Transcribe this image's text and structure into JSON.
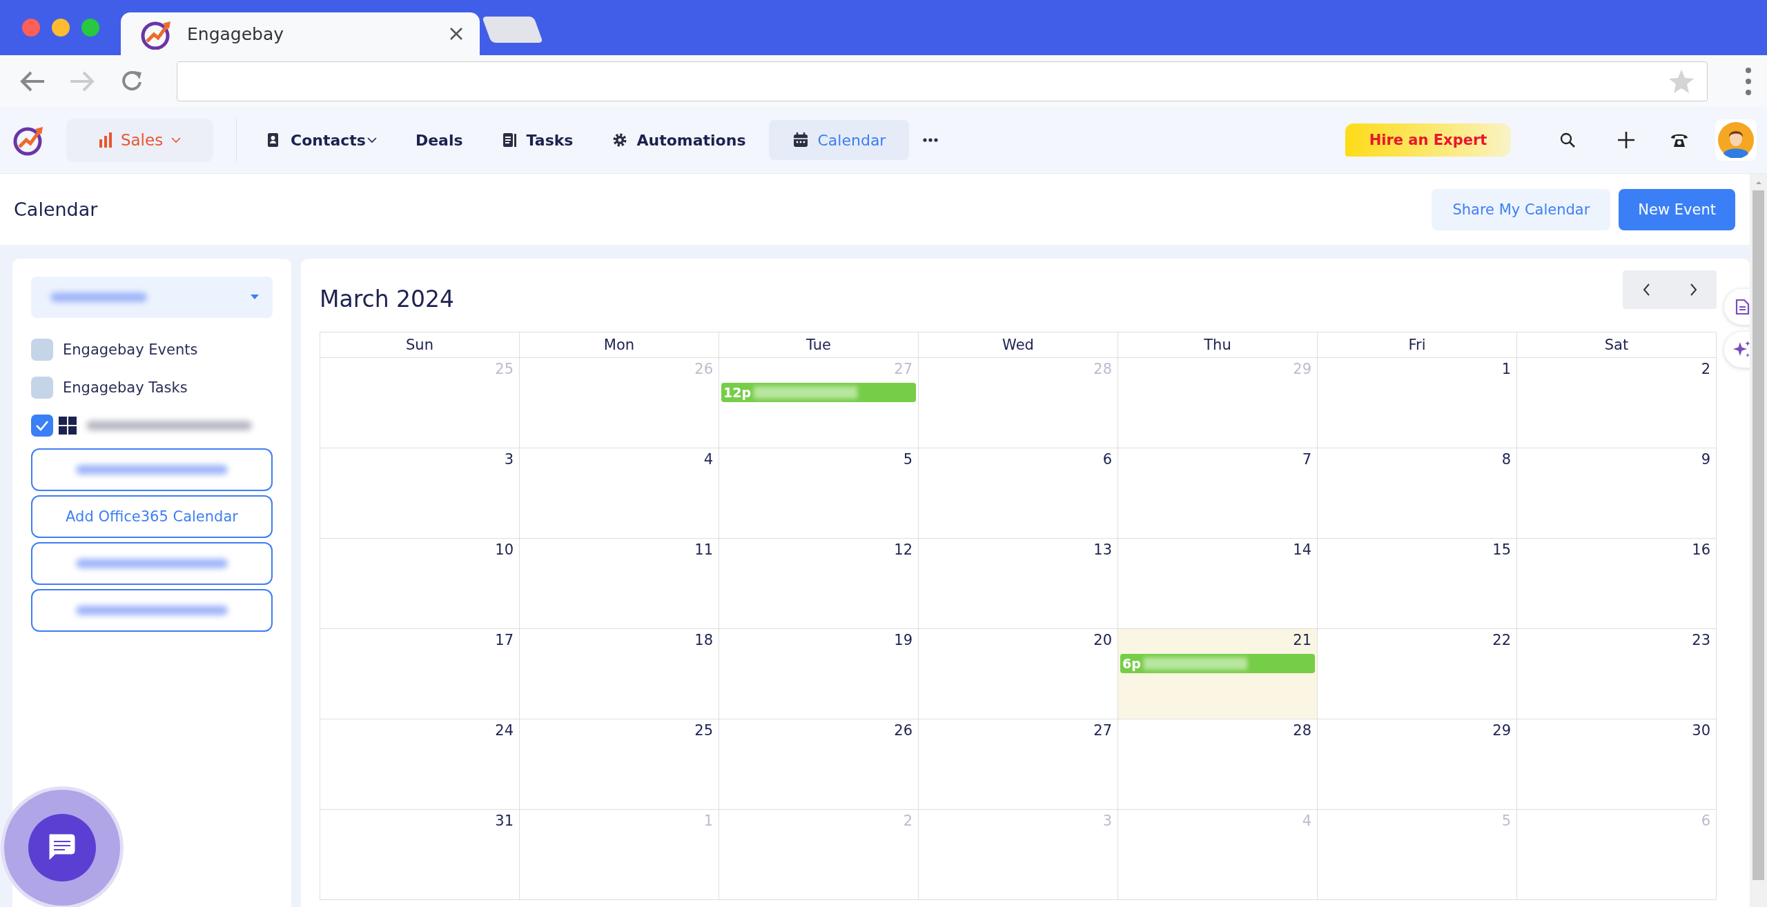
{
  "browser": {
    "tab_title": "Engagebay"
  },
  "nav": {
    "module": "Sales",
    "items": [
      {
        "label": "Contacts",
        "kind": "contacts",
        "dropdown": true,
        "selected": false
      },
      {
        "label": "Deals",
        "kind": "plain",
        "dropdown": false,
        "selected": false
      },
      {
        "label": "Tasks",
        "kind": "tasks",
        "dropdown": false,
        "selected": false
      },
      {
        "label": "Automations",
        "kind": "gear",
        "dropdown": false,
        "selected": false
      },
      {
        "label": "Calendar",
        "kind": "calendar",
        "dropdown": false,
        "selected": true
      }
    ],
    "hire_button": "Hire an Expert"
  },
  "page": {
    "title": "Calendar",
    "buttons": [
      {
        "label": "Share My Calendar",
        "kind": "secondary"
      },
      {
        "label": "New Event",
        "kind": "primary"
      }
    ]
  },
  "sidebar": {
    "calendars": [
      {
        "kind": "text",
        "label": "Engagebay Events",
        "checked": false
      },
      {
        "kind": "text",
        "label": "Engagebay Tasks",
        "checked": false
      },
      {
        "kind": "office",
        "checked": true
      }
    ],
    "add_buttons": [
      {
        "kind": "redacted"
      },
      {
        "kind": "text",
        "label": "Add Office365 Calendar"
      },
      {
        "kind": "redacted"
      },
      {
        "kind": "redacted"
      }
    ]
  },
  "calendar": {
    "title": "March 2024",
    "weekdays": [
      "Sun",
      "Mon",
      "Tue",
      "Wed",
      "Thu",
      "Fri",
      "Sat"
    ],
    "weeks": [
      [
        {
          "day": "25",
          "other_month": true
        },
        {
          "day": "26",
          "other_month": true
        },
        {
          "day": "27",
          "other_month": true,
          "events": [
            {
              "time": "12p"
            }
          ]
        },
        {
          "day": "28",
          "other_month": true
        },
        {
          "day": "29",
          "other_month": true
        },
        {
          "day": "1",
          "other_month": false
        },
        {
          "day": "2",
          "other_month": false
        }
      ],
      [
        {
          "day": "3",
          "other_month": false
        },
        {
          "day": "4",
          "other_month": false
        },
        {
          "day": "5",
          "other_month": false
        },
        {
          "day": "6",
          "other_month": false
        },
        {
          "day": "7",
          "other_month": false
        },
        {
          "day": "8",
          "other_month": false
        },
        {
          "day": "9",
          "other_month": false
        }
      ],
      [
        {
          "day": "10",
          "other_month": false
        },
        {
          "day": "11",
          "other_month": false
        },
        {
          "day": "12",
          "other_month": false
        },
        {
          "day": "13",
          "other_month": false
        },
        {
          "day": "14",
          "other_month": false
        },
        {
          "day": "15",
          "other_month": false
        },
        {
          "day": "16",
          "other_month": false
        }
      ],
      [
        {
          "day": "17",
          "other_month": false
        },
        {
          "day": "18",
          "other_month": false
        },
        {
          "day": "19",
          "other_month": false
        },
        {
          "day": "20",
          "other_month": false
        },
        {
          "day": "21",
          "other_month": false,
          "today": true,
          "events": [
            {
              "time": "6p"
            }
          ]
        },
        {
          "day": "22",
          "other_month": false
        },
        {
          "day": "23",
          "other_month": false
        }
      ],
      [
        {
          "day": "24",
          "other_month": false
        },
        {
          "day": "25",
          "other_month": false
        },
        {
          "day": "26",
          "other_month": false
        },
        {
          "day": "27",
          "other_month": false
        },
        {
          "day": "28",
          "other_month": false
        },
        {
          "day": "29",
          "other_month": false
        },
        {
          "day": "30",
          "other_month": false
        }
      ],
      [
        {
          "day": "31",
          "other_month": false
        },
        {
          "day": "1",
          "other_month": true
        },
        {
          "day": "2",
          "other_month": true
        },
        {
          "day": "3",
          "other_month": true
        },
        {
          "day": "4",
          "other_month": true
        },
        {
          "day": "5",
          "other_month": true
        },
        {
          "day": "6",
          "other_month": true
        }
      ]
    ]
  }
}
